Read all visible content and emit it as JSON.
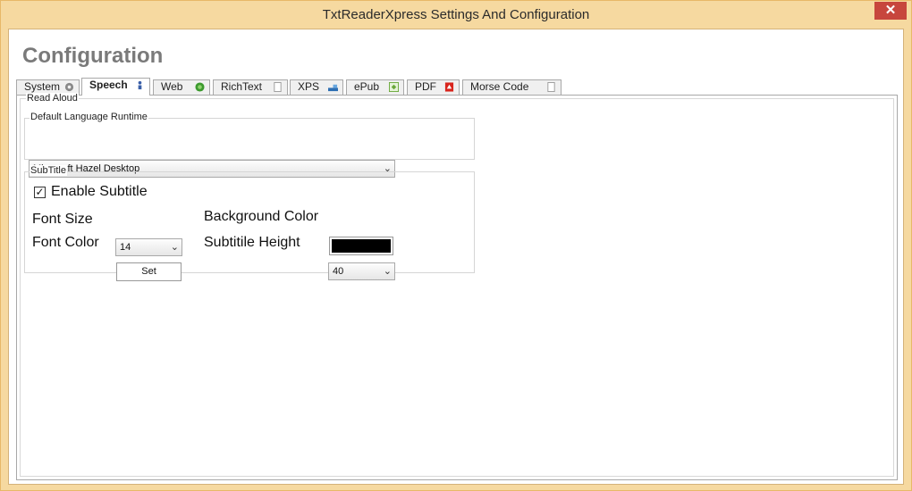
{
  "window": {
    "title": "TxtReaderXpress Settings And Configuration",
    "close_glyph": "✕"
  },
  "heading": "Configuration",
  "tabs": [
    {
      "label": "System",
      "icon": "gear-icon"
    },
    {
      "label": "Speech",
      "icon": "speaker-icon",
      "active": true
    },
    {
      "label": "Web",
      "icon": "globe-icon"
    },
    {
      "label": "RichText",
      "icon": "document-icon"
    },
    {
      "label": "XPS",
      "icon": "xps-icon"
    },
    {
      "label": "ePub",
      "icon": "epub-icon"
    },
    {
      "label": "PDF",
      "icon": "pdf-icon"
    },
    {
      "label": "Morse Code",
      "icon": "document-icon"
    }
  ],
  "read_aloud": {
    "label": "Read Aloud",
    "language": {
      "label": "Default Language Runtime",
      "selected": "Microsoft Hazel Desktop"
    }
  },
  "subtitle": {
    "label": "SubTitle",
    "enable_label": "Enable Subtitle",
    "enable_checked": true,
    "check_glyph": "✓",
    "font_size_label": "Font Size",
    "font_size_value": "14",
    "font_color_label": "Font Color",
    "set_label": "Set",
    "background_color_label": "Background Color",
    "background_color": "#000000",
    "height_label": "Subtitile Height",
    "height_value": "40"
  },
  "dropdown_glyph": "⌄",
  "colors": {
    "title_bar": "#f6d9a0",
    "close_button": "#c7463d",
    "heading": "#7a7a7a"
  }
}
